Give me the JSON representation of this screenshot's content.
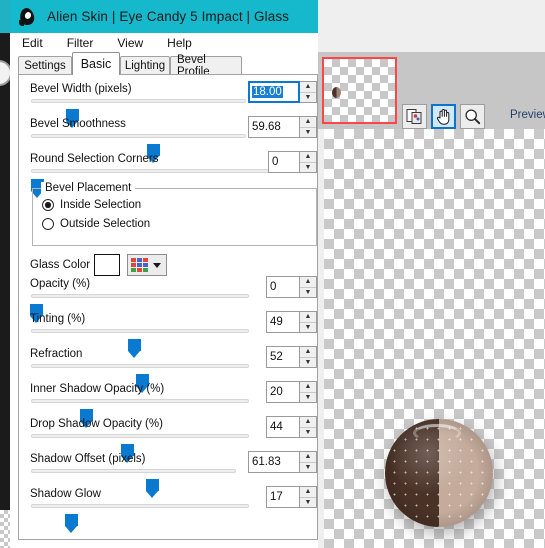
{
  "window": {
    "title": "Alien Skin | Eye Candy 5 Impact | Glass",
    "icon": "alien-head-icon",
    "titlebar_color": "#16b9cc"
  },
  "menu": {
    "items": [
      {
        "label": "Edit"
      },
      {
        "label": "Filter"
      },
      {
        "label": "View"
      },
      {
        "label": "Help"
      }
    ]
  },
  "tabs": [
    {
      "label": "Settings",
      "active": false
    },
    {
      "label": "Basic",
      "active": true
    },
    {
      "label": "Lighting",
      "active": false
    },
    {
      "label": "Bevel Profile",
      "active": false
    }
  ],
  "controls": [
    {
      "name": "bevel-width",
      "label": "Bevel Width (pixels)",
      "value": "18.00",
      "percent": 19,
      "focused": true
    },
    {
      "name": "bevel-smoothness",
      "label": "Bevel Smoothness",
      "value": "59.68",
      "percent": 57,
      "focused": false
    },
    {
      "name": "round-selection-corners",
      "label": "Round Selection Corners",
      "value": "0",
      "percent": 2,
      "focused": false
    },
    {
      "name": "opacity",
      "label": "Opacity (%)",
      "value": "0",
      "percent": 2,
      "focused": false
    },
    {
      "name": "tinting",
      "label": "Tinting (%)",
      "value": "49",
      "percent": 47,
      "focused": false
    },
    {
      "name": "refraction",
      "label": "Refraction",
      "value": "52",
      "percent": 51,
      "focused": false
    },
    {
      "name": "inner-shadow-opacity",
      "label": "Inner Shadow Opacity (%)",
      "value": "20",
      "percent": 25,
      "focused": false
    },
    {
      "name": "drop-shadow-opacity",
      "label": "Drop Shadow Opacity (%)",
      "value": "44",
      "percent": 44,
      "focused": false
    },
    {
      "name": "shadow-offset",
      "label": "Shadow Offset (pixels)",
      "value": "61.83",
      "percent": 59,
      "focused": false
    },
    {
      "name": "shadow-glow",
      "label": "Shadow Glow",
      "value": "17",
      "percent": 18,
      "focused": false
    }
  ],
  "bevel_placement": {
    "group_label": "Bevel Placement",
    "options": [
      {
        "label": "Inside Selection",
        "selected": true
      },
      {
        "label": "Outside Selection",
        "selected": false
      }
    ]
  },
  "glass_color": {
    "label": "Glass Color",
    "swatch_color": "#ffffff",
    "picker_icon": "color-grid-icon",
    "picker_colors": [
      "#e0473a",
      "#4a63c8",
      "#e0473a",
      "#e0473a",
      "#4a63c8",
      "#4a63c8",
      "#3fa04a",
      "#e0473a",
      "#3fa04a"
    ]
  },
  "spinner": {
    "up_glyph": "▲",
    "down_glyph": "▼"
  },
  "preview": {
    "label": "Preview",
    "navigator_border_color": "#ff4545",
    "tools": [
      {
        "name": "compare-preview-tool",
        "icon": "image-compare-icon",
        "selected": false
      },
      {
        "name": "pan-tool",
        "icon": "hand-icon",
        "selected": true
      },
      {
        "name": "zoom-tool",
        "icon": "magnifier-icon",
        "selected": false
      }
    ]
  }
}
